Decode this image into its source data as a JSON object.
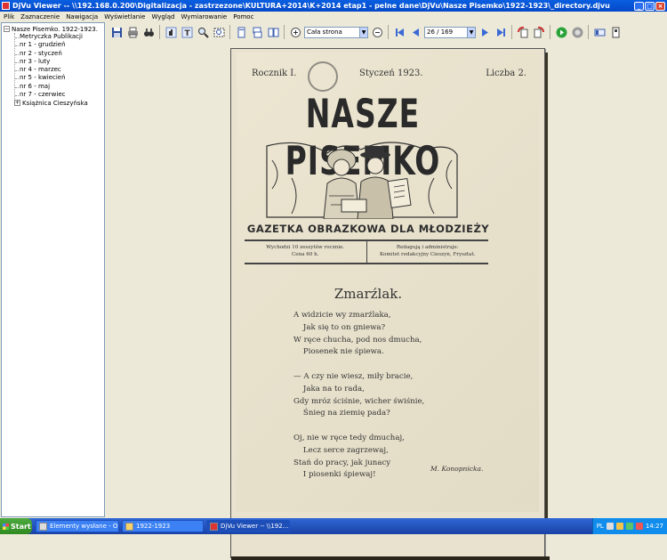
{
  "window": {
    "title": "DjVu Viewer -- \\\\192.168.0.200\\Digitalizacja - zastrzezone\\KULTURA+2014\\K+2014 etap1 - pelne dane\\DjVu\\Nasze Pisemko\\1922-1923\\_directory.djvu"
  },
  "menu": [
    "Plik",
    "Zaznaczenie",
    "Nawigacja",
    "Wyświetlanie",
    "Wygląd",
    "Wymiarowanie",
    "Pomoc"
  ],
  "tree": {
    "root": "Nasze Pisemko. 1922-1923.",
    "children": [
      "Metryczka Publikacji",
      "nr 1 - grudzień",
      "nr 2 - styczeń",
      "nr 3 - luty",
      "nr 4 - marzec",
      "nr 5 - kwiecień",
      "nr 6 - maj",
      "nr 7 - czerwiec"
    ],
    "sibling": "Książnica Cieszyńska"
  },
  "toolbar": {
    "zoom": "Cała strona",
    "page": "26 / 169"
  },
  "document": {
    "rocznik": "Rocznik I.",
    "date": "Styczeń 1923.",
    "liczba": "Liczba 2.",
    "masthead": "NASZE PISEMKO",
    "subtitle": "GAZETKA OBRAZKOWA DLA MŁODZIEŻY",
    "info_left_1": "Wychodzi 10 zeszytów rocznie.",
    "info_left_2": "Cena 60 h.",
    "info_right_1": "Redagują i administruje:",
    "info_right_2": "Komitet redakcyjny Cieszyn, Frysztat.",
    "poem_title": "Zmarźlak.",
    "poem": "A widzicie wy zmarźlaka,\n    Jak się to on gniewa?\nW ręce chucha, pod nos dmucha,\n    Piosenek nie śpiewa.\n\n— A czy nie wiesz, miły bracie,\n    Jaka na to rada,\nGdy mróz ściśnie, wicher świśnie,\n    Śnieg na ziemię pada?\n\nOj, nie w ręce tedy dmuchaj,\n    Lecz serce zagrzewaj,\nStań do pracy, jak junacy\n    I piosenki śpiewaj!",
    "author": "M. Konopnicka."
  },
  "taskbar": {
    "start": "Start",
    "tasks": [
      "Elementy wysłane - Outl...",
      "1922-1923",
      "DjVu Viewer -- \\\\192...."
    ],
    "lang": "PL",
    "time": "14:27"
  }
}
